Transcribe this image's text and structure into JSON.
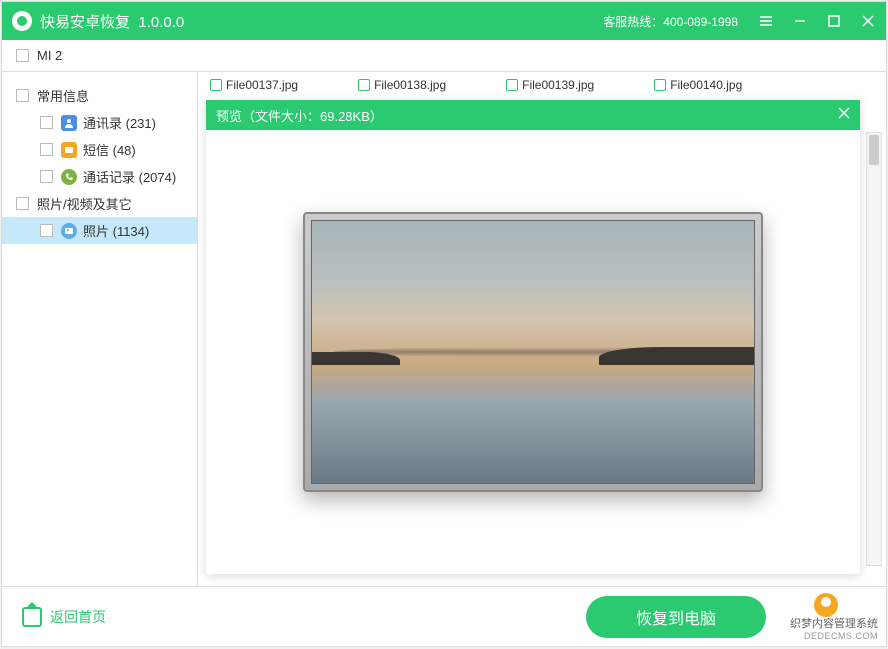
{
  "titlebar": {
    "app_name": "快易安卓恢复",
    "version": "1.0.0.0",
    "hotline_label": "客服热线：400-089-1998"
  },
  "device": {
    "name": "MI 2"
  },
  "sidebar": {
    "category1": {
      "label": "常用信息",
      "items": [
        {
          "label": "通讯录 (231)"
        },
        {
          "label": "短信 (48)"
        },
        {
          "label": "通话记录 (2074)"
        }
      ]
    },
    "category2": {
      "label": "照片/视频及其它",
      "items": [
        {
          "label": "照片 (1134)"
        }
      ]
    }
  },
  "files": [
    {
      "name": "File00137.jpg"
    },
    {
      "name": "File00138.jpg"
    },
    {
      "name": "File00139.jpg"
    },
    {
      "name": "File00140.jpg"
    }
  ],
  "preview": {
    "title": "预览（文件大小：69.28KB）"
  },
  "footer": {
    "back_label": "返回首页",
    "recover_label": "恢复到电脑"
  },
  "watermark": {
    "line1": "织梦内容管理系统",
    "line2": "DEDECMS.COM"
  }
}
